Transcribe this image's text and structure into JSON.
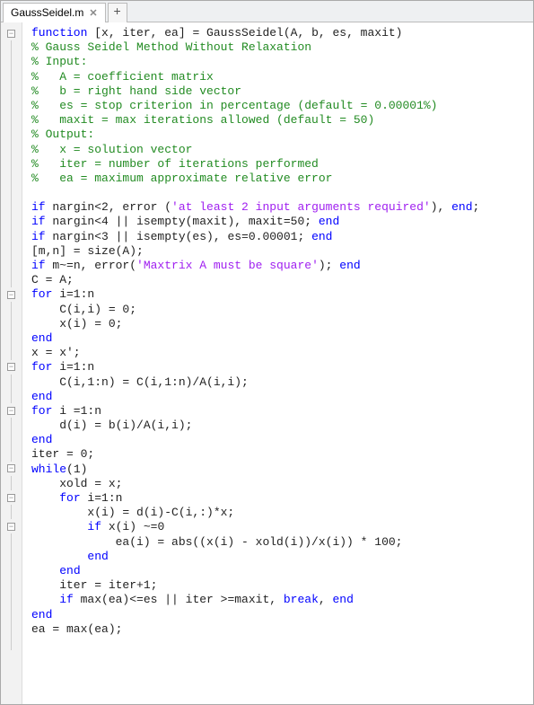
{
  "tab": {
    "title": "GaussSeidel.m"
  },
  "code_lines": [
    {
      "fold": "box",
      "segs": [
        {
          "cls": "k",
          "t": "function"
        },
        {
          "cls": "",
          "t": " [x, iter, ea] = GaussSeidel(A, b, es, maxit)"
        }
      ]
    },
    {
      "fold": "line",
      "segs": [
        {
          "cls": "c",
          "t": "% Gauss Seidel Method Without Relaxation"
        }
      ]
    },
    {
      "fold": "line",
      "segs": [
        {
          "cls": "c",
          "t": "% Input:"
        }
      ]
    },
    {
      "fold": "line",
      "segs": [
        {
          "cls": "c",
          "t": "%   A = coefficient matrix"
        }
      ]
    },
    {
      "fold": "line",
      "segs": [
        {
          "cls": "c",
          "t": "%   b = right hand side vector"
        }
      ]
    },
    {
      "fold": "line",
      "segs": [
        {
          "cls": "c",
          "t": "%   es = stop criterion in percentage (default = 0.00001%)"
        }
      ]
    },
    {
      "fold": "line",
      "segs": [
        {
          "cls": "c",
          "t": "%   maxit = max iterations allowed (default = 50)"
        }
      ]
    },
    {
      "fold": "line",
      "segs": [
        {
          "cls": "c",
          "t": "% Output:"
        }
      ]
    },
    {
      "fold": "line",
      "segs": [
        {
          "cls": "c",
          "t": "%   x = solution vector"
        }
      ]
    },
    {
      "fold": "line",
      "segs": [
        {
          "cls": "c",
          "t": "%   iter = number of iterations performed"
        }
      ]
    },
    {
      "fold": "line",
      "segs": [
        {
          "cls": "c",
          "t": "%   ea = maximum approximate relative error"
        }
      ]
    },
    {
      "fold": "line",
      "segs": [
        {
          "cls": "",
          "t": ""
        }
      ]
    },
    {
      "fold": "line",
      "segs": [
        {
          "cls": "k",
          "t": "if"
        },
        {
          "cls": "",
          "t": " nargin<2, error ("
        },
        {
          "cls": "s",
          "t": "'at least 2 input arguments required'"
        },
        {
          "cls": "",
          "t": "), "
        },
        {
          "cls": "k",
          "t": "end"
        },
        {
          "cls": "",
          "t": ";"
        }
      ]
    },
    {
      "fold": "line",
      "segs": [
        {
          "cls": "k",
          "t": "if"
        },
        {
          "cls": "",
          "t": " nargin<4 || isempty(maxit), maxit=50; "
        },
        {
          "cls": "k",
          "t": "end"
        }
      ]
    },
    {
      "fold": "line",
      "segs": [
        {
          "cls": "k",
          "t": "if"
        },
        {
          "cls": "",
          "t": " nargin<3 || isempty(es), es=0.00001; "
        },
        {
          "cls": "k",
          "t": "end"
        }
      ]
    },
    {
      "fold": "line",
      "segs": [
        {
          "cls": "",
          "t": "[m,n] = size(A);"
        }
      ]
    },
    {
      "fold": "line",
      "segs": [
        {
          "cls": "k",
          "t": "if"
        },
        {
          "cls": "",
          "t": " m~=n, error("
        },
        {
          "cls": "s",
          "t": "'Maxtrix A must be square'"
        },
        {
          "cls": "",
          "t": "); "
        },
        {
          "cls": "k",
          "t": "end"
        }
      ]
    },
    {
      "fold": "line",
      "segs": [
        {
          "cls": "",
          "t": "C = A;"
        }
      ]
    },
    {
      "fold": "box",
      "segs": [
        {
          "cls": "k",
          "t": "for"
        },
        {
          "cls": "",
          "t": " i=1:n"
        }
      ]
    },
    {
      "fold": "line",
      "segs": [
        {
          "cls": "",
          "t": "    C(i,i) = 0;"
        }
      ]
    },
    {
      "fold": "line",
      "segs": [
        {
          "cls": "",
          "t": "    x(i) = 0;"
        }
      ]
    },
    {
      "fold": "line",
      "segs": [
        {
          "cls": "k",
          "t": "end"
        }
      ]
    },
    {
      "fold": "line",
      "segs": [
        {
          "cls": "",
          "t": "x = x';"
        }
      ]
    },
    {
      "fold": "box",
      "segs": [
        {
          "cls": "k",
          "t": "for"
        },
        {
          "cls": "",
          "t": " i=1:n"
        }
      ]
    },
    {
      "fold": "line",
      "segs": [
        {
          "cls": "",
          "t": "    C(i,1:n) = C(i,1:n)/A(i,i);"
        }
      ]
    },
    {
      "fold": "line",
      "segs": [
        {
          "cls": "k",
          "t": "end"
        }
      ]
    },
    {
      "fold": "box",
      "segs": [
        {
          "cls": "k",
          "t": "for"
        },
        {
          "cls": "",
          "t": " i =1:n"
        }
      ]
    },
    {
      "fold": "line",
      "segs": [
        {
          "cls": "",
          "t": "    d(i) = b(i)/A(i,i);"
        }
      ]
    },
    {
      "fold": "line",
      "segs": [
        {
          "cls": "k",
          "t": "end"
        }
      ]
    },
    {
      "fold": "line",
      "segs": [
        {
          "cls": "",
          "t": "iter = 0;"
        }
      ]
    },
    {
      "fold": "box",
      "segs": [
        {
          "cls": "k",
          "t": "while"
        },
        {
          "cls": "",
          "t": "(1)"
        }
      ]
    },
    {
      "fold": "line",
      "segs": [
        {
          "cls": "",
          "t": "    xold = x;"
        }
      ]
    },
    {
      "fold": "box",
      "segs": [
        {
          "cls": "",
          "t": "    "
        },
        {
          "cls": "k",
          "t": "for"
        },
        {
          "cls": "",
          "t": " i=1:n"
        }
      ]
    },
    {
      "fold": "line",
      "segs": [
        {
          "cls": "",
          "t": "        x(i) = d(i)-C(i,:)*x;"
        }
      ]
    },
    {
      "fold": "box",
      "segs": [
        {
          "cls": "",
          "t": "        "
        },
        {
          "cls": "k",
          "t": "if"
        },
        {
          "cls": "",
          "t": " x(i) ~=0"
        }
      ]
    },
    {
      "fold": "line",
      "segs": [
        {
          "cls": "",
          "t": "            ea(i) = abs((x(i) - xold(i))/x(i)) * 100;"
        }
      ]
    },
    {
      "fold": "line",
      "segs": [
        {
          "cls": "",
          "t": "        "
        },
        {
          "cls": "k",
          "t": "end"
        }
      ]
    },
    {
      "fold": "line",
      "segs": [
        {
          "cls": "",
          "t": "    "
        },
        {
          "cls": "k",
          "t": "end"
        }
      ]
    },
    {
      "fold": "line",
      "segs": [
        {
          "cls": "",
          "t": "    iter = iter+1;"
        }
      ]
    },
    {
      "fold": "line",
      "segs": [
        {
          "cls": "",
          "t": "    "
        },
        {
          "cls": "k",
          "t": "if"
        },
        {
          "cls": "",
          "t": " max(ea)<=es || iter >=maxit, "
        },
        {
          "cls": "k",
          "t": "break"
        },
        {
          "cls": "",
          "t": ", "
        },
        {
          "cls": "k",
          "t": "end"
        }
      ]
    },
    {
      "fold": "line",
      "segs": [
        {
          "cls": "k",
          "t": "end"
        }
      ]
    },
    {
      "fold": "line",
      "segs": [
        {
          "cls": "",
          "t": "ea = max(ea);"
        }
      ]
    },
    {
      "fold": "line",
      "segs": [
        {
          "cls": "",
          "t": ""
        }
      ]
    }
  ]
}
